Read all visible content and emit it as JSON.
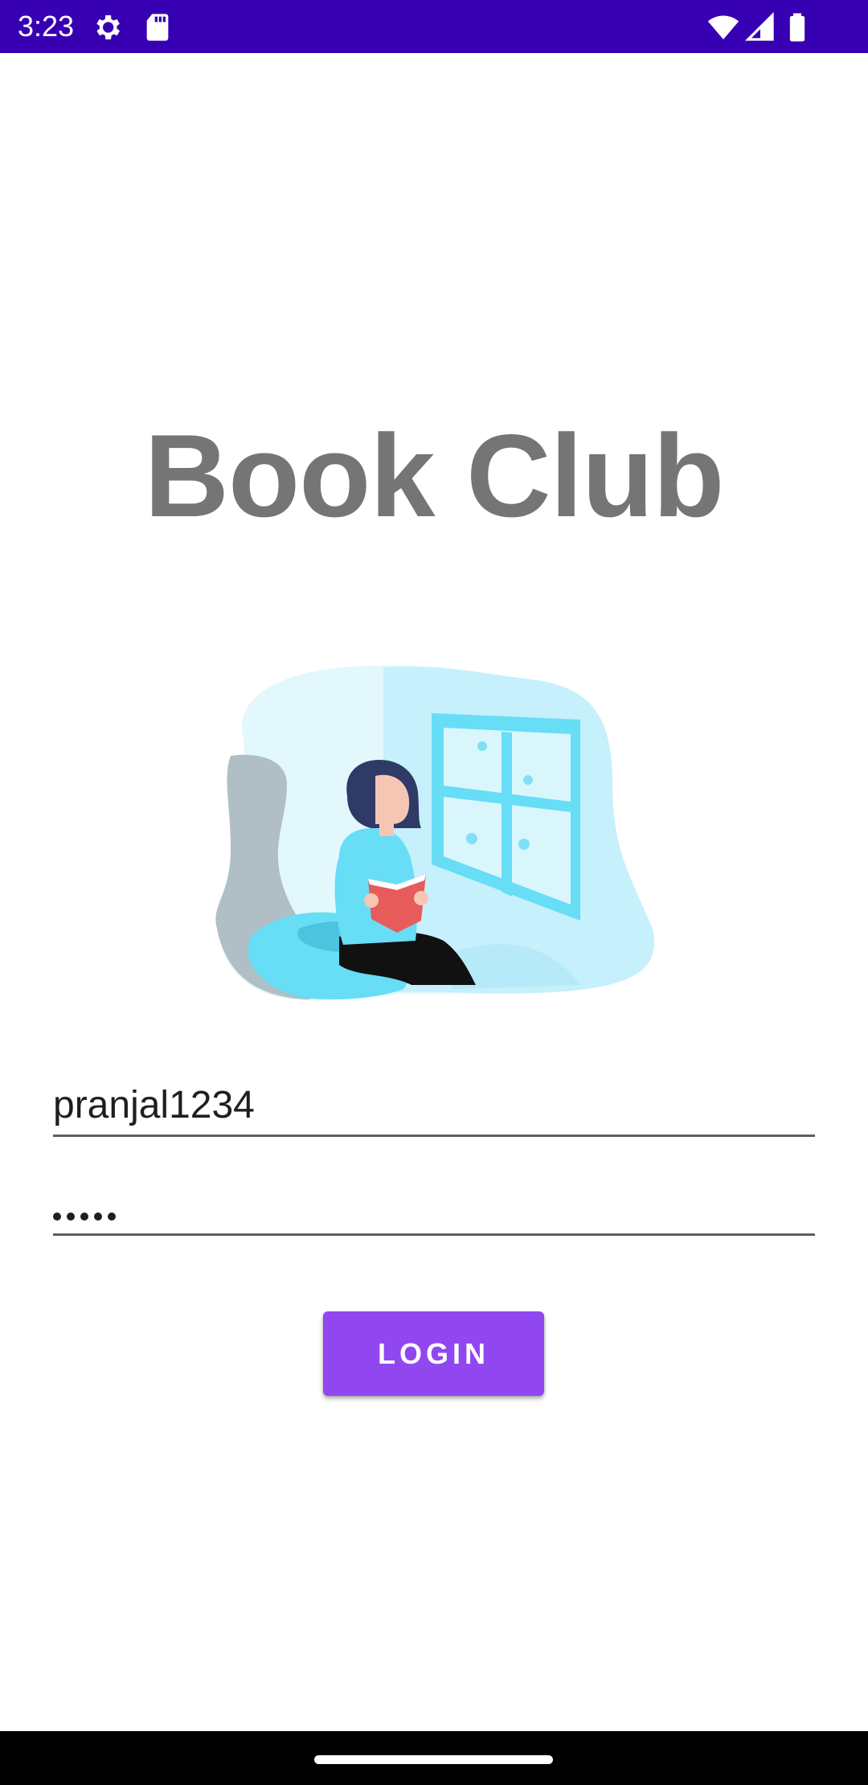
{
  "status_bar": {
    "time": "3:23",
    "icons": [
      "settings-icon",
      "sd-card-icon",
      "wifi-icon",
      "signal-icon",
      "battery-icon"
    ],
    "background_color": "#3700b3"
  },
  "title": "Book Club",
  "illustration": "reading-woman-by-window",
  "login_form": {
    "username_value": "pranjal1234",
    "password_masked_length": 5,
    "login_label": "LOGIN"
  },
  "colors": {
    "accent": "#9147f0",
    "title": "#757575",
    "field_underline": "#5f5f5f"
  }
}
